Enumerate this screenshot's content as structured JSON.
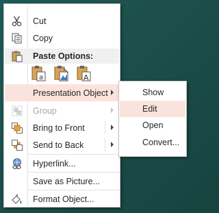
{
  "context_menu": {
    "items": [
      {
        "label": "Cut",
        "icon": "scissors-icon"
      },
      {
        "label": "Copy",
        "icon": "copy-icon"
      },
      {
        "label": "Presentation Object",
        "icon": ""
      },
      {
        "label": "Group",
        "icon": "group-icon"
      },
      {
        "label": "Bring to Front",
        "icon": "bring-to-front-icon"
      },
      {
        "label": "Send to Back",
        "icon": "send-to-back-icon"
      },
      {
        "label": "Hyperlink...",
        "icon": "hyperlink-icon"
      },
      {
        "label": "Save as Picture...",
        "icon": ""
      },
      {
        "label": "Format Object...",
        "icon": "format-object-icon"
      }
    ],
    "paste_options_label": "Paste Options:",
    "paste_buttons": [
      {
        "name": "paste-keep-source-formatting",
        "glyph": "a"
      },
      {
        "name": "paste-picture",
        "glyph": ""
      },
      {
        "name": "paste-keep-text-only",
        "glyph": "A"
      }
    ]
  },
  "submenu": {
    "items": [
      {
        "label": "Show"
      },
      {
        "label": "Edit"
      },
      {
        "label": "Open"
      },
      {
        "label": "Convert..."
      }
    ]
  },
  "colors": {
    "highlight": "#fbe3dd",
    "background": "#1d4f4b",
    "accent_orange": "#d9822b"
  }
}
